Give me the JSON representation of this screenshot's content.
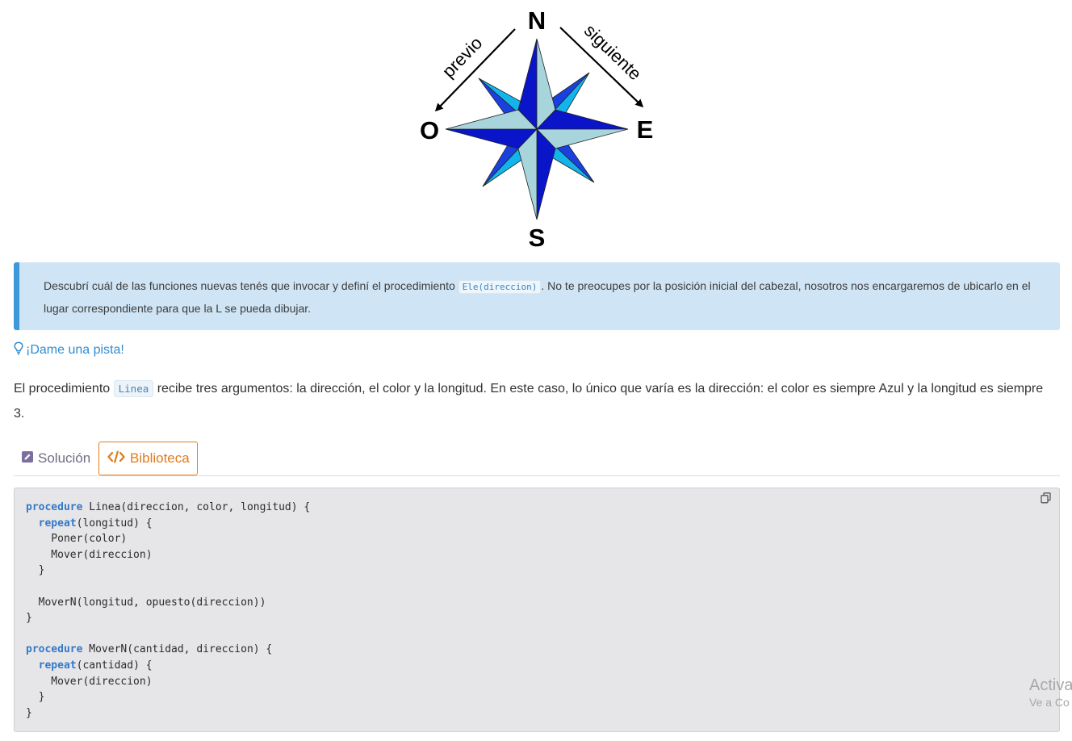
{
  "compass": {
    "north": "N",
    "south": "S",
    "east": "E",
    "west": "O",
    "previous_label": "previo",
    "next_label": "siguiente"
  },
  "instructions": {
    "text_before": "Descubrí cuál de las funciones nuevas tenés que invocar y definí el procedimiento ",
    "code": "Ele(direccion)",
    "text_after": ". No te preocupes por la posición inicial del cabezal, nosotros nos encargaremos de ubicarlo en el lugar correspondiente para que la L se pueda dibujar."
  },
  "hint": {
    "link_label": "¡Dame una pista!",
    "text_before": "El procedimiento ",
    "code": "Linea",
    "text_after": " recibe tres argumentos: la dirección, el color y la longitud. En este caso, lo único que varía es la dirección: el color es siempre Azul y la longitud es siempre 3."
  },
  "tabs": {
    "solucion": "Solución",
    "biblioteca": "Biblioteca",
    "active": "biblioteca"
  },
  "code_lines": [
    [
      [
        "kw",
        "procedure"
      ],
      [
        "",
        " Linea(direccion, color, longitud) {"
      ]
    ],
    [
      [
        "",
        "  "
      ],
      [
        "kw",
        "repeat"
      ],
      [
        "",
        "(longitud) {"
      ]
    ],
    [
      [
        "",
        "    Poner(color)"
      ]
    ],
    [
      [
        "",
        "    Mover(direccion)"
      ]
    ],
    [
      [
        "",
        "  }"
      ]
    ],
    [
      [
        "",
        ""
      ]
    ],
    [
      [
        "",
        "  MoverN(longitud, opuesto(direccion))"
      ]
    ],
    [
      [
        "",
        "}"
      ]
    ],
    [
      [
        "",
        ""
      ]
    ],
    [
      [
        "kw",
        "procedure"
      ],
      [
        "",
        " MoverN(cantidad, direccion) {"
      ]
    ],
    [
      [
        "",
        "  "
      ],
      [
        "kw",
        "repeat"
      ],
      [
        "",
        "(cantidad) {"
      ]
    ],
    [
      [
        "",
        "    Mover(direccion)"
      ]
    ],
    [
      [
        "",
        "  }"
      ]
    ],
    [
      [
        "",
        "}"
      ]
    ]
  ],
  "watermark": {
    "line1": "Activa",
    "line2": "Ve a Co"
  },
  "colors": {
    "alert_bg": "#cfe4f4",
    "alert_border": "#3f98d8",
    "link": "#2f8dd1",
    "tab_active": "#e07b1c",
    "code_keyword": "#3479c5",
    "compass_dark": "#0a14c8",
    "compass_light": "#a8d4dc",
    "compass_cyan": "#12b4ea",
    "compass_mid": "#1a40e0"
  }
}
